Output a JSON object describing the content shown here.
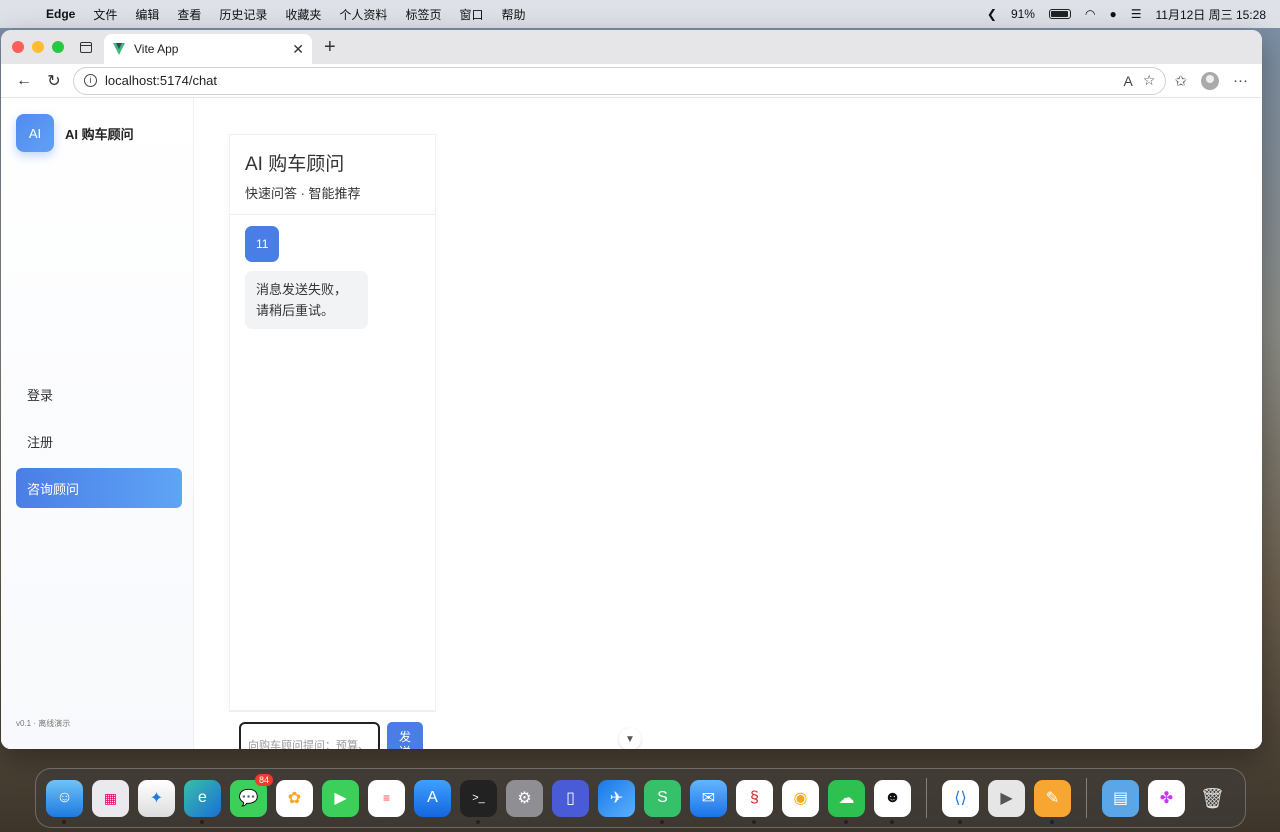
{
  "menubar": {
    "app_name": "Edge",
    "items": [
      "文件",
      "编辑",
      "查看",
      "历史记录",
      "收藏夹",
      "个人资料",
      "标签页",
      "窗口",
      "帮助"
    ],
    "battery": "91%",
    "datetime": "11月12日 周三  15:28"
  },
  "browser": {
    "tab_title": "Vite App",
    "url": "localhost:5174/chat"
  },
  "sidebar": {
    "logo_text": "AI",
    "brand_name": "AI 购车顾问",
    "nav": [
      {
        "label": "登录"
      },
      {
        "label": "注册"
      },
      {
        "label": "咨询顾问",
        "active": true
      }
    ],
    "version": "v0.1 · 离线演示"
  },
  "chat": {
    "title": "AI 购车顾问",
    "subtitle": "快速问答 · 智能推荐",
    "messages": [
      {
        "role": "user",
        "text": "11"
      },
      {
        "role": "bot",
        "text": "消息发送失败，请稍后重试。"
      }
    ],
    "input_placeholder": "向购车顾问提问：预算、",
    "send_label": "发送"
  },
  "dock": {
    "messages_badge": "84",
    "apps": [
      "finder-icon",
      "launchpad-icon",
      "safari-icon",
      "edge-icon",
      "messages-icon",
      "photos-icon",
      "facetime-icon",
      "reminders-icon",
      "app-store-icon",
      "terminal-icon",
      "system-settings-icon",
      "simulator-icon",
      "xcode-icon",
      "wps-icon",
      "mail-icon",
      "app-icon",
      "chrome-like-icon",
      "wechat-icon",
      "qq-icon",
      "vscode-icon",
      "app-icon-2",
      "pages-icon",
      "folder-icon",
      "app-icon-3",
      "trash-icon"
    ]
  }
}
